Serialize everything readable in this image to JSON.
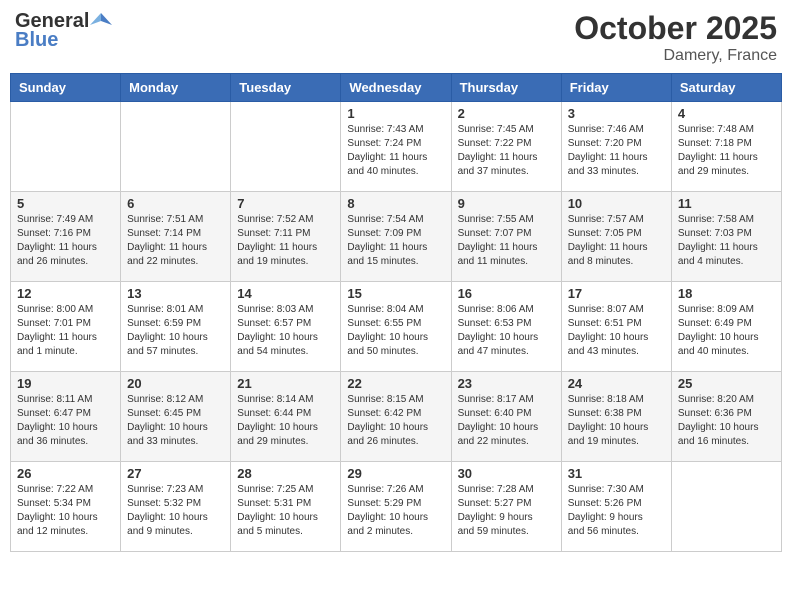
{
  "logo": {
    "general": "General",
    "blue": "Blue"
  },
  "title": "October 2025",
  "location": "Damery, France",
  "weekdays": [
    "Sunday",
    "Monday",
    "Tuesday",
    "Wednesday",
    "Thursday",
    "Friday",
    "Saturday"
  ],
  "weeks": [
    [
      {
        "day": "",
        "info": ""
      },
      {
        "day": "",
        "info": ""
      },
      {
        "day": "",
        "info": ""
      },
      {
        "day": "1",
        "info": "Sunrise: 7:43 AM\nSunset: 7:24 PM\nDaylight: 11 hours\nand 40 minutes."
      },
      {
        "day": "2",
        "info": "Sunrise: 7:45 AM\nSunset: 7:22 PM\nDaylight: 11 hours\nand 37 minutes."
      },
      {
        "day": "3",
        "info": "Sunrise: 7:46 AM\nSunset: 7:20 PM\nDaylight: 11 hours\nand 33 minutes."
      },
      {
        "day": "4",
        "info": "Sunrise: 7:48 AM\nSunset: 7:18 PM\nDaylight: 11 hours\nand 29 minutes."
      }
    ],
    [
      {
        "day": "5",
        "info": "Sunrise: 7:49 AM\nSunset: 7:16 PM\nDaylight: 11 hours\nand 26 minutes."
      },
      {
        "day": "6",
        "info": "Sunrise: 7:51 AM\nSunset: 7:14 PM\nDaylight: 11 hours\nand 22 minutes."
      },
      {
        "day": "7",
        "info": "Sunrise: 7:52 AM\nSunset: 7:11 PM\nDaylight: 11 hours\nand 19 minutes."
      },
      {
        "day": "8",
        "info": "Sunrise: 7:54 AM\nSunset: 7:09 PM\nDaylight: 11 hours\nand 15 minutes."
      },
      {
        "day": "9",
        "info": "Sunrise: 7:55 AM\nSunset: 7:07 PM\nDaylight: 11 hours\nand 11 minutes."
      },
      {
        "day": "10",
        "info": "Sunrise: 7:57 AM\nSunset: 7:05 PM\nDaylight: 11 hours\nand 8 minutes."
      },
      {
        "day": "11",
        "info": "Sunrise: 7:58 AM\nSunset: 7:03 PM\nDaylight: 11 hours\nand 4 minutes."
      }
    ],
    [
      {
        "day": "12",
        "info": "Sunrise: 8:00 AM\nSunset: 7:01 PM\nDaylight: 11 hours\nand 1 minute."
      },
      {
        "day": "13",
        "info": "Sunrise: 8:01 AM\nSunset: 6:59 PM\nDaylight: 10 hours\nand 57 minutes."
      },
      {
        "day": "14",
        "info": "Sunrise: 8:03 AM\nSunset: 6:57 PM\nDaylight: 10 hours\nand 54 minutes."
      },
      {
        "day": "15",
        "info": "Sunrise: 8:04 AM\nSunset: 6:55 PM\nDaylight: 10 hours\nand 50 minutes."
      },
      {
        "day": "16",
        "info": "Sunrise: 8:06 AM\nSunset: 6:53 PM\nDaylight: 10 hours\nand 47 minutes."
      },
      {
        "day": "17",
        "info": "Sunrise: 8:07 AM\nSunset: 6:51 PM\nDaylight: 10 hours\nand 43 minutes."
      },
      {
        "day": "18",
        "info": "Sunrise: 8:09 AM\nSunset: 6:49 PM\nDaylight: 10 hours\nand 40 minutes."
      }
    ],
    [
      {
        "day": "19",
        "info": "Sunrise: 8:11 AM\nSunset: 6:47 PM\nDaylight: 10 hours\nand 36 minutes."
      },
      {
        "day": "20",
        "info": "Sunrise: 8:12 AM\nSunset: 6:45 PM\nDaylight: 10 hours\nand 33 minutes."
      },
      {
        "day": "21",
        "info": "Sunrise: 8:14 AM\nSunset: 6:44 PM\nDaylight: 10 hours\nand 29 minutes."
      },
      {
        "day": "22",
        "info": "Sunrise: 8:15 AM\nSunset: 6:42 PM\nDaylight: 10 hours\nand 26 minutes."
      },
      {
        "day": "23",
        "info": "Sunrise: 8:17 AM\nSunset: 6:40 PM\nDaylight: 10 hours\nand 22 minutes."
      },
      {
        "day": "24",
        "info": "Sunrise: 8:18 AM\nSunset: 6:38 PM\nDaylight: 10 hours\nand 19 minutes."
      },
      {
        "day": "25",
        "info": "Sunrise: 8:20 AM\nSunset: 6:36 PM\nDaylight: 10 hours\nand 16 minutes."
      }
    ],
    [
      {
        "day": "26",
        "info": "Sunrise: 7:22 AM\nSunset: 5:34 PM\nDaylight: 10 hours\nand 12 minutes."
      },
      {
        "day": "27",
        "info": "Sunrise: 7:23 AM\nSunset: 5:32 PM\nDaylight: 10 hours\nand 9 minutes."
      },
      {
        "day": "28",
        "info": "Sunrise: 7:25 AM\nSunset: 5:31 PM\nDaylight: 10 hours\nand 5 minutes."
      },
      {
        "day": "29",
        "info": "Sunrise: 7:26 AM\nSunset: 5:29 PM\nDaylight: 10 hours\nand 2 minutes."
      },
      {
        "day": "30",
        "info": "Sunrise: 7:28 AM\nSunset: 5:27 PM\nDaylight: 9 hours\nand 59 minutes."
      },
      {
        "day": "31",
        "info": "Sunrise: 7:30 AM\nSunset: 5:26 PM\nDaylight: 9 hours\nand 56 minutes."
      },
      {
        "day": "",
        "info": ""
      }
    ]
  ]
}
